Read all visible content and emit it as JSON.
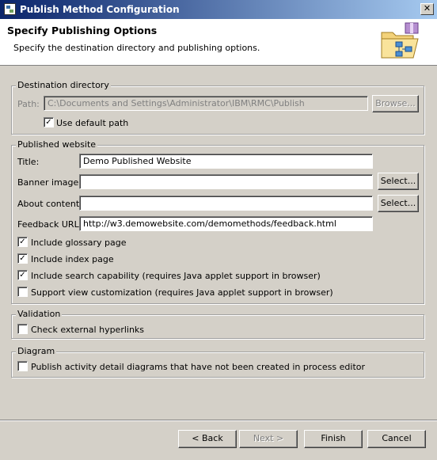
{
  "window": {
    "title": "Publish Method Configuration",
    "close_label": "✕"
  },
  "header": {
    "title": "Specify Publishing Options",
    "description": "Specify the destination directory and publishing options."
  },
  "destination": {
    "group_label": "Destination directory",
    "path_label": "Path:",
    "path_value": "C:\\Documents and Settings\\Administrator\\IBM\\RMC\\Publish",
    "browse_label": "Browse...",
    "use_default_label": "Use default path",
    "use_default_checked": true
  },
  "website": {
    "group_label": "Published website",
    "title_label": "Title:",
    "title_value": "Demo Published Website",
    "banner_label": "Banner image:",
    "banner_value": "",
    "banner_select": "Select...",
    "about_label": "About content:",
    "about_value": "",
    "about_select": "Select...",
    "feedback_label": "Feedback URL:",
    "feedback_value": "http://w3.demowebsite.com/demomethods/feedback.html",
    "options": [
      {
        "label": "Include glossary page",
        "checked": true
      },
      {
        "label": "Include index page",
        "checked": true
      },
      {
        "label": "Include search capability (requires Java applet support in browser)",
        "checked": true
      },
      {
        "label": "Support view customization (requires Java applet support in browser)",
        "checked": false
      }
    ]
  },
  "validation": {
    "group_label": "Validation",
    "check_links_label": "Check external hyperlinks",
    "checked": false
  },
  "diagram": {
    "group_label": "Diagram",
    "publish_label": "Publish activity detail diagrams that have not been created in process editor",
    "checked": false
  },
  "buttons": {
    "back": "< Back",
    "next": "Next >",
    "finish": "Finish",
    "cancel": "Cancel"
  }
}
